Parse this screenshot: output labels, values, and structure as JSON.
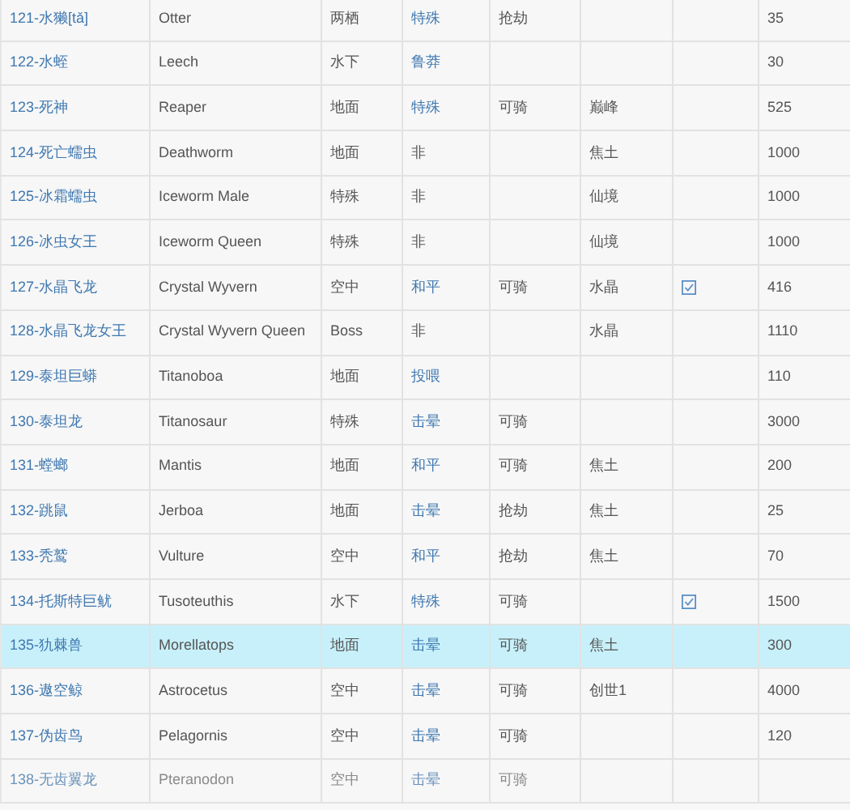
{
  "table": {
    "rows": [
      {
        "column_1": "121-水獭[tǎ]",
        "column_2": "Otter",
        "column_3": "两栖",
        "column_4": {
          "text": "特殊",
          "link": true
        },
        "column_5": "抢劫",
        "column_7": {
          "checked": false
        },
        "column_8": "35",
        "selected": false,
        "faded": false
      },
      {
        "column_1": "122-水蛭",
        "column_2": "Leech",
        "column_3": "水下",
        "column_4": {
          "text": "鲁莽",
          "link": true
        },
        "column_7": {
          "checked": false
        },
        "column_8": "30",
        "selected": false,
        "faded": false
      },
      {
        "column_1": "123-死神",
        "column_2": "Reaper",
        "column_3": "地面",
        "column_4": {
          "text": "特殊",
          "link": true
        },
        "column_5": "可骑",
        "column_6": "巅峰",
        "column_7": {
          "checked": false
        },
        "column_8": "525",
        "selected": false,
        "faded": false
      },
      {
        "column_1": "124-死亡蠕虫",
        "column_2": "Deathworm",
        "column_3": "地面",
        "column_4": {
          "text": "非",
          "link": false
        },
        "column_6": "焦土",
        "column_7": {
          "checked": false
        },
        "column_8": "1000",
        "selected": false,
        "faded": false
      },
      {
        "column_1": "125-冰霜蠕虫",
        "column_2": "Iceworm Male",
        "column_3": "特殊",
        "column_4": {
          "text": "非",
          "link": false
        },
        "column_6": "仙境",
        "column_7": {
          "checked": false
        },
        "column_8": "1000",
        "selected": false,
        "faded": false
      },
      {
        "column_1": "126-冰虫女王",
        "column_2": "Iceworm Queen",
        "column_3": "特殊",
        "column_4": {
          "text": "非",
          "link": false
        },
        "column_6": "仙境",
        "column_7": {
          "checked": false
        },
        "column_8": "1000",
        "selected": false,
        "faded": false
      },
      {
        "column_1": "127-水晶飞龙",
        "column_2": "Crystal Wyvern",
        "column_3": "空中",
        "column_4": {
          "text": "和平",
          "link": true
        },
        "column_5": "可骑",
        "column_6": "水晶",
        "column_7": {
          "checked": true
        },
        "column_8": "416",
        "selected": false,
        "faded": false
      },
      {
        "column_1": "128-水晶飞龙女王",
        "column_2": "Crystal Wyvern Queen",
        "column_3": "Boss",
        "column_4": {
          "text": "非",
          "link": false
        },
        "column_6": "水晶",
        "column_7": {
          "checked": false
        },
        "column_8": "1110",
        "selected": false,
        "faded": false
      },
      {
        "column_1": "129-泰坦巨蟒",
        "column_2": "Titanoboa",
        "column_3": "地面",
        "column_4": {
          "text": "投喂",
          "link": true
        },
        "column_7": {
          "checked": false
        },
        "column_8": "110",
        "selected": false,
        "faded": false
      },
      {
        "column_1": "130-泰坦龙",
        "column_2": "Titanosaur",
        "column_3": "特殊",
        "column_4": {
          "text": "击晕",
          "link": true
        },
        "column_5": "可骑",
        "column_7": {
          "checked": false
        },
        "column_8": "3000",
        "selected": false,
        "faded": false
      },
      {
        "column_1": "131-螳螂",
        "column_2": "Mantis",
        "column_3": "地面",
        "column_4": {
          "text": "和平",
          "link": true
        },
        "column_5": "可骑",
        "column_6": "焦土",
        "column_7": {
          "checked": false
        },
        "column_8": "200",
        "selected": false,
        "faded": false
      },
      {
        "column_1": "132-跳鼠",
        "column_2": "Jerboa",
        "column_3": "地面",
        "column_4": {
          "text": "击晕",
          "link": true
        },
        "column_5": "抢劫",
        "column_6": "焦土",
        "column_7": {
          "checked": false
        },
        "column_8": "25",
        "selected": false,
        "faded": false
      },
      {
        "column_1": "133-秃鹫",
        "column_2": "Vulture",
        "column_3": "空中",
        "column_4": {
          "text": "和平",
          "link": true
        },
        "column_5": "抢劫",
        "column_6": "焦土",
        "column_7": {
          "checked": false
        },
        "column_8": "70",
        "selected": false,
        "faded": false
      },
      {
        "column_1": "134-托斯特巨鱿",
        "column_2": "Tusoteuthis",
        "column_3": "水下",
        "column_4": {
          "text": "特殊",
          "link": true
        },
        "column_5": "可骑",
        "column_7": {
          "checked": true
        },
        "column_8": "1500",
        "selected": false,
        "faded": false
      },
      {
        "column_1": "135-犰棘兽",
        "column_2": "Morellatops",
        "column_3": "地面",
        "column_4": {
          "text": "击晕",
          "link": true
        },
        "column_5": "可骑",
        "column_6": "焦土",
        "column_7": {
          "checked": false
        },
        "column_8": "300",
        "selected": true,
        "faded": false
      },
      {
        "column_1": "136-遨空鲸",
        "column_2": "Astrocetus",
        "column_3": "空中",
        "column_4": {
          "text": "击晕",
          "link": true
        },
        "column_5": "可骑",
        "column_6": "创世1",
        "column_7": {
          "checked": false
        },
        "column_8": "4000",
        "selected": false,
        "faded": false
      },
      {
        "column_1": "137-伪齿鸟",
        "column_2": "Pelagornis",
        "column_3": "空中",
        "column_4": {
          "text": "击晕",
          "link": true
        },
        "column_5": "可骑",
        "column_7": {
          "checked": false
        },
        "column_8": "120",
        "selected": false,
        "faded": false
      },
      {
        "column_1": "138-无齿翼龙",
        "column_2": "Pteranodon",
        "column_3": "空中",
        "column_4": {
          "text": "击晕",
          "link": true
        },
        "column_5": "可骑",
        "column_7": {
          "checked": false
        },
        "column_8": "",
        "selected": false,
        "faded": true
      }
    ]
  }
}
